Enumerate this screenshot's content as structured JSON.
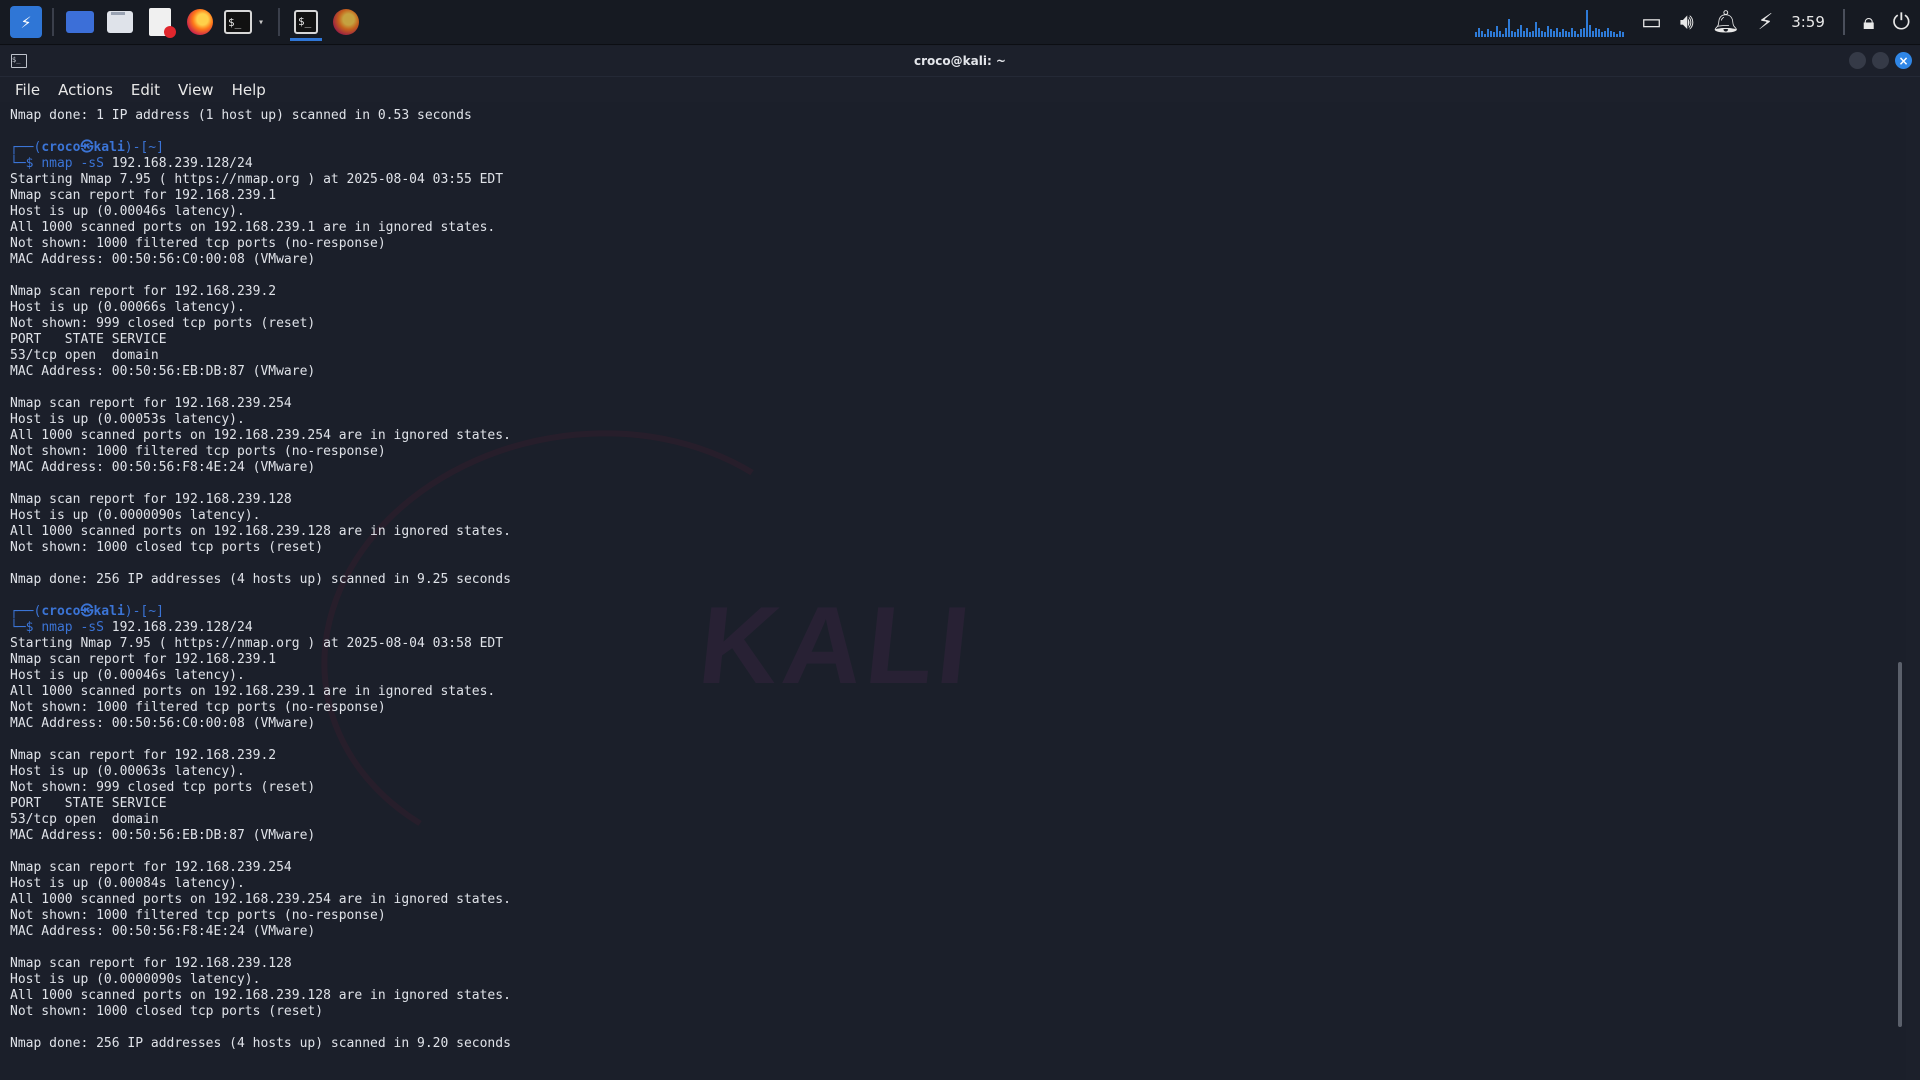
{
  "taskbar": {
    "launchers": [
      {
        "icon": "kali-menu-icon",
        "label": ""
      },
      {
        "icon": "workspace-icon",
        "label": "..."
      },
      {
        "icon": "file-manager-icon",
        "label": ""
      },
      {
        "icon": "text-editor-icon",
        "label": ""
      },
      {
        "icon": "firefox-icon",
        "label": ""
      },
      {
        "icon": "terminal-icon",
        "label": "$_"
      }
    ],
    "open_windows": [
      {
        "icon": "terminal-icon",
        "label": "$_"
      },
      {
        "icon": "firefox-icon",
        "label": ""
      }
    ],
    "tray": {
      "clock": "3:59",
      "icons": [
        "window-icon",
        "volume-icon",
        "notification-bell-icon",
        "power-icon",
        "lock-icon",
        "logout-icon"
      ]
    },
    "graph_levels": [
      0.15,
      0.3,
      0.2,
      0.1,
      0.25,
      0.2,
      0.15,
      0.35,
      0.2,
      0.1,
      0.3,
      0.6,
      0.2,
      0.15,
      0.25,
      0.4,
      0.2,
      0.3,
      0.15,
      0.2,
      0.5,
      0.3,
      0.2,
      0.15,
      0.35,
      0.25,
      0.2,
      0.3,
      0.15,
      0.25,
      0.2,
      0.15,
      0.3,
      0.2,
      0.1,
      0.25,
      0.3,
      0.9,
      0.4,
      0.2,
      0.3,
      0.25,
      0.15,
      0.2,
      0.3,
      0.2,
      0.15,
      0.1,
      0.2,
      0.15
    ],
    "accent": "#2e7bd8"
  },
  "window": {
    "title": "croco@kali: ~",
    "icon_glyph": "$_",
    "close_glyph": "×",
    "menu": [
      "File",
      "Actions",
      "Edit",
      "View",
      "Help"
    ]
  },
  "terminal": {
    "watermark": "KALI",
    "prompt": {
      "corner_top": "┌──(",
      "user": "croco",
      "at": "㉿",
      "host": "kali",
      "path_part": ")-[~]",
      "corner_bottom": "└─$ ",
      "cmd": "nmap -sS",
      "arg": "192.168.239.128/24"
    },
    "lines": [
      {
        "type": "out",
        "text": "Nmap done: 1 IP address (1 host up) scanned in 0.53 seconds"
      },
      {
        "type": "blank",
        "text": ""
      },
      {
        "type": "prompt-top",
        "text": ""
      },
      {
        "type": "prompt-cmd",
        "text": ""
      },
      {
        "type": "out",
        "text": "Starting Nmap 7.95 ( https://nmap.org ) at 2025-08-04 03:55 EDT"
      },
      {
        "type": "out",
        "text": "Nmap scan report for 192.168.239.1"
      },
      {
        "type": "out",
        "text": "Host is up (0.00046s latency)."
      },
      {
        "type": "out",
        "text": "All 1000 scanned ports on 192.168.239.1 are in ignored states."
      },
      {
        "type": "out",
        "text": "Not shown: 1000 filtered tcp ports (no-response)"
      },
      {
        "type": "out",
        "text": "MAC Address: 00:50:56:C0:00:08 (VMware)"
      },
      {
        "type": "blank",
        "text": ""
      },
      {
        "type": "out",
        "text": "Nmap scan report for 192.168.239.2"
      },
      {
        "type": "out",
        "text": "Host is up (0.00066s latency)."
      },
      {
        "type": "out",
        "text": "Not shown: 999 closed tcp ports (reset)"
      },
      {
        "type": "out",
        "text": "PORT   STATE SERVICE"
      },
      {
        "type": "out",
        "text": "53/tcp open  domain"
      },
      {
        "type": "out",
        "text": "MAC Address: 00:50:56:EB:DB:87 (VMware)"
      },
      {
        "type": "blank",
        "text": ""
      },
      {
        "type": "out",
        "text": "Nmap scan report for 192.168.239.254"
      },
      {
        "type": "out",
        "text": "Host is up (0.00053s latency)."
      },
      {
        "type": "out",
        "text": "All 1000 scanned ports on 192.168.239.254 are in ignored states."
      },
      {
        "type": "out",
        "text": "Not shown: 1000 filtered tcp ports (no-response)"
      },
      {
        "type": "out",
        "text": "MAC Address: 00:50:56:F8:4E:24 (VMware)"
      },
      {
        "type": "blank",
        "text": ""
      },
      {
        "type": "out",
        "text": "Nmap scan report for 192.168.239.128"
      },
      {
        "type": "out",
        "text": "Host is up (0.0000090s latency)."
      },
      {
        "type": "out",
        "text": "All 1000 scanned ports on 192.168.239.128 are in ignored states."
      },
      {
        "type": "out",
        "text": "Not shown: 1000 closed tcp ports (reset)"
      },
      {
        "type": "blank",
        "text": ""
      },
      {
        "type": "out",
        "text": "Nmap done: 256 IP addresses (4 hosts up) scanned in 9.25 seconds"
      },
      {
        "type": "blank",
        "text": ""
      },
      {
        "type": "prompt-top",
        "text": ""
      },
      {
        "type": "prompt-cmd",
        "text": ""
      },
      {
        "type": "out",
        "text": "Starting Nmap 7.95 ( https://nmap.org ) at 2025-08-04 03:58 EDT"
      },
      {
        "type": "out",
        "text": "Nmap scan report for 192.168.239.1"
      },
      {
        "type": "out",
        "text": "Host is up (0.00046s latency)."
      },
      {
        "type": "out",
        "text": "All 1000 scanned ports on 192.168.239.1 are in ignored states."
      },
      {
        "type": "out",
        "text": "Not shown: 1000 filtered tcp ports (no-response)"
      },
      {
        "type": "out",
        "text": "MAC Address: 00:50:56:C0:00:08 (VMware)"
      },
      {
        "type": "blank",
        "text": ""
      },
      {
        "type": "out",
        "text": "Nmap scan report for 192.168.239.2"
      },
      {
        "type": "out",
        "text": "Host is up (0.00063s latency)."
      },
      {
        "type": "out",
        "text": "Not shown: 999 closed tcp ports (reset)"
      },
      {
        "type": "out",
        "text": "PORT   STATE SERVICE"
      },
      {
        "type": "out",
        "text": "53/tcp open  domain"
      },
      {
        "type": "out",
        "text": "MAC Address: 00:50:56:EB:DB:87 (VMware)"
      },
      {
        "type": "blank",
        "text": ""
      },
      {
        "type": "out",
        "text": "Nmap scan report for 192.168.239.254"
      },
      {
        "type": "out",
        "text": "Host is up (0.00084s latency)."
      },
      {
        "type": "out",
        "text": "All 1000 scanned ports on 192.168.239.254 are in ignored states."
      },
      {
        "type": "out",
        "text": "Not shown: 1000 filtered tcp ports (no-response)"
      },
      {
        "type": "out",
        "text": "MAC Address: 00:50:56:F8:4E:24 (VMware)"
      },
      {
        "type": "blank",
        "text": ""
      },
      {
        "type": "out",
        "text": "Nmap scan report for 192.168.239.128"
      },
      {
        "type": "out",
        "text": "Host is up (0.0000090s latency)."
      },
      {
        "type": "out",
        "text": "All 1000 scanned ports on 192.168.239.128 are in ignored states."
      },
      {
        "type": "out",
        "text": "Not shown: 1000 closed tcp ports (reset)"
      },
      {
        "type": "blank",
        "text": ""
      },
      {
        "type": "out",
        "text": "Nmap done: 256 IP addresses (4 hosts up) scanned in 9.20 seconds"
      }
    ]
  }
}
